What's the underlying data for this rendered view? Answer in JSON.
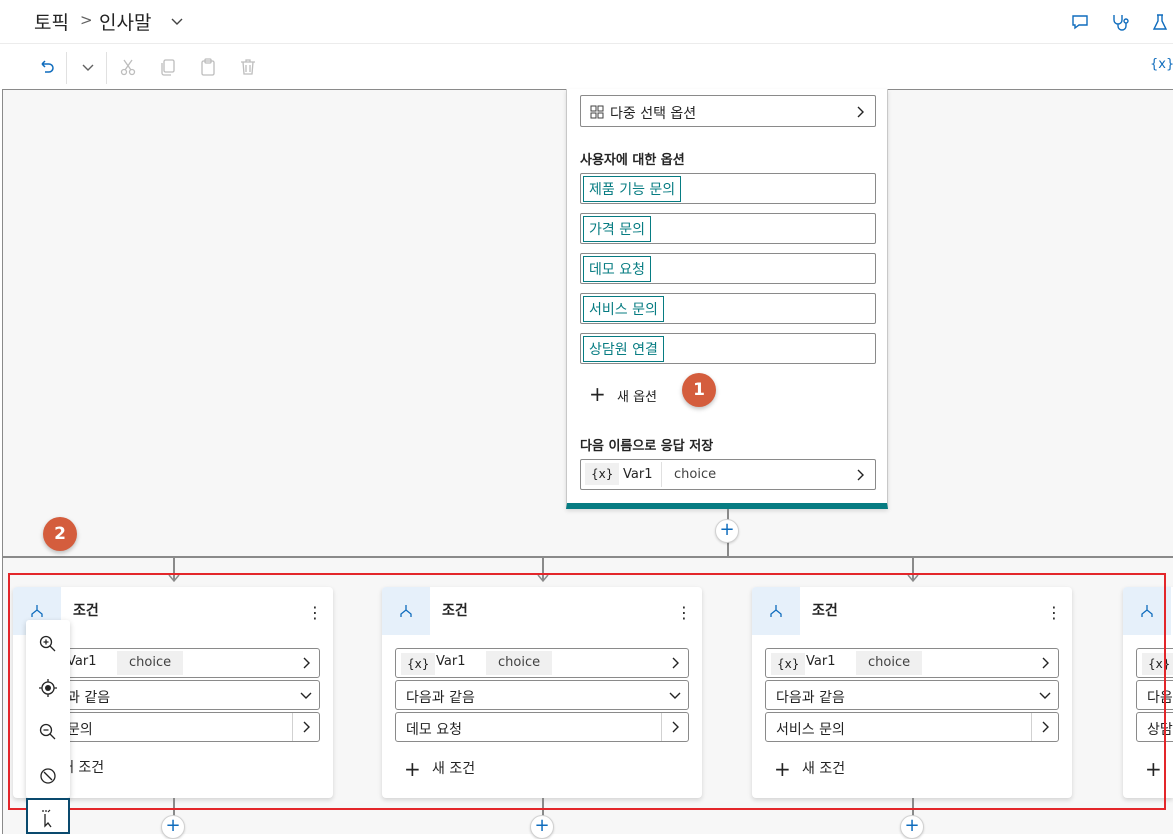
{
  "header": {
    "breadcrumb_root": "토픽",
    "separator": ">",
    "title": "인사말"
  },
  "toolbar": {
    "variables_label": "{x}"
  },
  "question_node": {
    "multi_select_label": "다중 선택 옵션",
    "options_heading": "사용자에 대한 옵션",
    "options": [
      "제품 기능 문의",
      "가격 문의",
      "데모 요청",
      "서비스 문의",
      "상담원 연결"
    ],
    "new_option_label": "새 옵션",
    "save_heading": "다음 이름으로 응답 저장",
    "var_icon": "{x}",
    "var_name": "Var1",
    "var_type": "choice"
  },
  "badges": {
    "one": "1",
    "two": "2"
  },
  "conditions": [
    {
      "title": "조건",
      "var_icon": "{x}",
      "var_name": "Var1",
      "var_type": "choice",
      "operator": "과 같음",
      "value": "문의",
      "new_condition": "새 조건"
    },
    {
      "title": "조건",
      "var_icon": "{x}",
      "var_name": "Var1",
      "var_type": "choice",
      "operator": "다음과 같음",
      "value": "데모 요청",
      "new_condition": "새 조건"
    },
    {
      "title": "조건",
      "var_icon": "{x}",
      "var_name": "Var1",
      "var_type": "choice",
      "operator": "다음과 같음",
      "value": "서비스 문의",
      "new_condition": "새 조건"
    },
    {
      "title": "",
      "var_icon": "{x}",
      "var_name": "",
      "var_type": "",
      "operator": "다음",
      "value": "상담",
      "new_condition": ""
    }
  ],
  "colors": {
    "accent": "#0f6cbd",
    "teal": "#077c82",
    "badge": "#d45d3d",
    "highlight": "#e3262a"
  }
}
